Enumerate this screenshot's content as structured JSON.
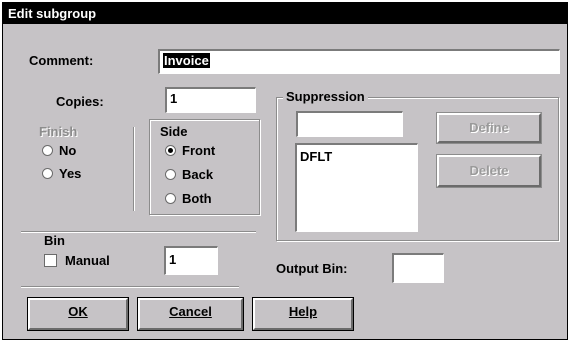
{
  "title": "Edit subgroup",
  "comment": {
    "label": "Comment:",
    "value": "Invoice"
  },
  "copies": {
    "label": "Copies:",
    "value": "1"
  },
  "finish": {
    "label": "Finish",
    "options": [
      "No",
      "Yes"
    ]
  },
  "side": {
    "label": "Side",
    "options": [
      "Front",
      "Back",
      "Both"
    ],
    "selected": "Front"
  },
  "suppression": {
    "label": "Suppression",
    "input_value": "",
    "list_items": [
      "DFLT"
    ],
    "define_label": "Define",
    "delete_label": "Delete"
  },
  "bin": {
    "label": "Bin",
    "manual_label": "Manual",
    "value": "1"
  },
  "output_bin": {
    "label": "Output Bin:",
    "value": ""
  },
  "buttons": {
    "ok": "OK",
    "cancel": "Cancel",
    "help": "Help"
  }
}
